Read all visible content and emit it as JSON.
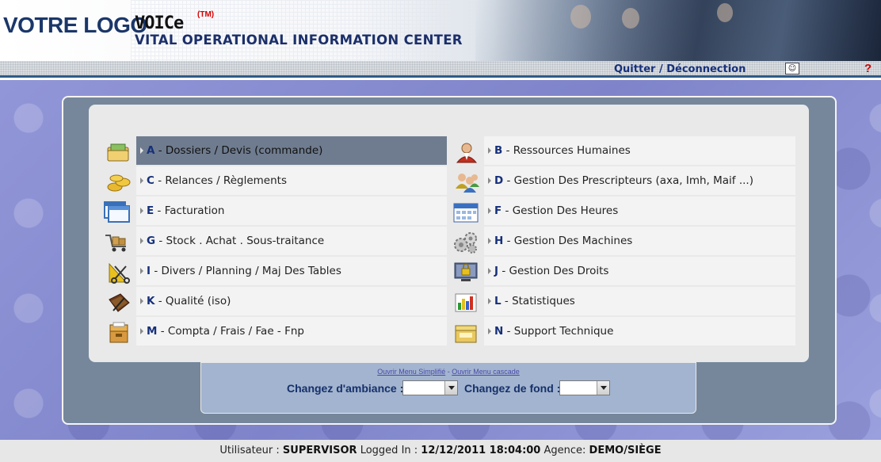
{
  "header": {
    "logo": "VOTRE LOGO",
    "brand": "VOICe",
    "tm": "(TM)",
    "subtitle": "VITAL OPERATIONAL INFORMATION CENTER"
  },
  "topbar": {
    "logout": "Quitter / Déconnection",
    "help": "?"
  },
  "menu": {
    "items": [
      {
        "letter": "A",
        "label": " - Dossiers / Devis (commande)",
        "icon": "folder-money-icon",
        "selected": true
      },
      {
        "letter": "B",
        "label": " - Ressources Humaines",
        "icon": "person-icon"
      },
      {
        "letter": "C",
        "label": " - Relances / Règlements",
        "icon": "coins-icon"
      },
      {
        "letter": "D",
        "label": " - Gestion Des Prescripteurs (axa, Imh, Maif ...)",
        "icon": "users-group-icon"
      },
      {
        "letter": "E",
        "label": " - Facturation",
        "icon": "windows-icon"
      },
      {
        "letter": "F",
        "label": " - Gestion Des Heures",
        "icon": "calendar-icon"
      },
      {
        "letter": "G",
        "label": " - Stock . Achat . Sous-traitance",
        "icon": "cart-icon"
      },
      {
        "letter": "H",
        "label": " - Gestion Des Machines",
        "icon": "gears-icon"
      },
      {
        "letter": "I",
        "label": " - Divers / Planning / Maj Des Tables",
        "icon": "scissors-ruler-icon"
      },
      {
        "letter": "J",
        "label": " - Gestion Des Droits",
        "icon": "monitor-lock-icon"
      },
      {
        "letter": "K",
        "label": " - Qualité (iso)",
        "icon": "book-pen-icon"
      },
      {
        "letter": "L",
        "label": " - Statistiques",
        "icon": "bar-chart-icon"
      },
      {
        "letter": "M",
        "label": " - Compta / Frais / Fae - Fnp",
        "icon": "file-cabinet-icon"
      },
      {
        "letter": "N",
        "label": " - Support Technique",
        "icon": "support-box-icon"
      }
    ]
  },
  "options": {
    "link_simplifie": "Ouvrir Menu Simplifié",
    "separator": " - ",
    "link_cascade": "Ouvrir Menu cascade",
    "ambiance_label": "Changez d'ambiance :",
    "ambiance_value": "",
    "fond_label": "Changez de fond :",
    "fond_value": ""
  },
  "footer": {
    "user_label": "Utilisateur : ",
    "user": "SUPERVISOR",
    "logged_label": " Logged In : ",
    "datetime": "12/12/2011 18:04:00",
    "agency_label": " Agence: ",
    "agency": "DEMO/SIÈGE"
  },
  "colors": {
    "accent": "#16307a",
    "selected_row": "#6f7c8f",
    "frame": "#76879c",
    "background": "#8a8fd3"
  }
}
